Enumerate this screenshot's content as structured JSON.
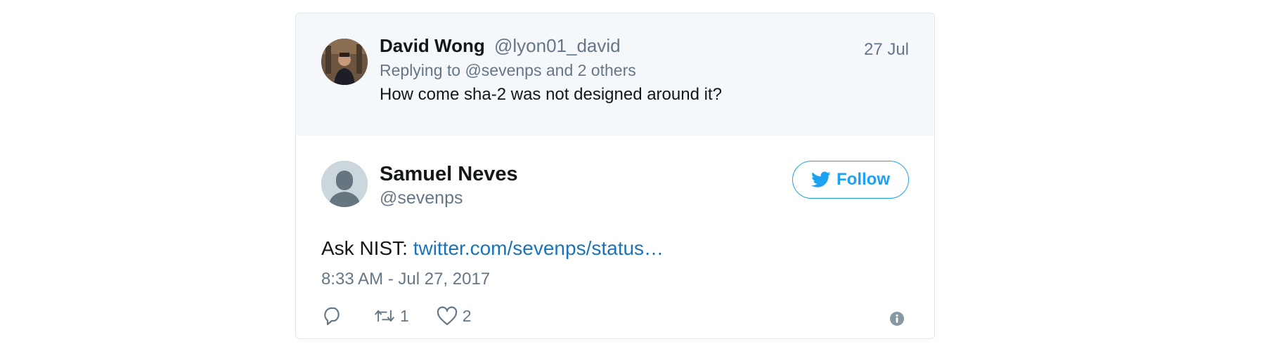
{
  "reply_tweet": {
    "author_name": "David Wong",
    "author_handle": "@lyon01_david",
    "date": "27 Jul",
    "replying_to": "Replying to @sevenps and 2 others",
    "text": "How come sha-2 was not designed around it?"
  },
  "main_tweet": {
    "author_name": "Samuel Neves",
    "author_handle": "@sevenps",
    "follow_label": "Follow",
    "text_prefix": "Ask NIST: ",
    "link_text": "twitter.com/sevenps/status…",
    "timestamp": "8:33 AM - Jul 27, 2017",
    "retweet_count": "1",
    "like_count": "2"
  },
  "icons": {
    "reply": "reply-icon",
    "retweet": "retweet-icon",
    "like": "heart-icon",
    "info": "info-icon",
    "follow": "twitter-bird-icon"
  },
  "colors": {
    "accent": "#1da1f2",
    "link": "#1b73b9",
    "muted": "#657786",
    "reply_bg": "#f5f8fa",
    "border": "#e1e8ed"
  }
}
